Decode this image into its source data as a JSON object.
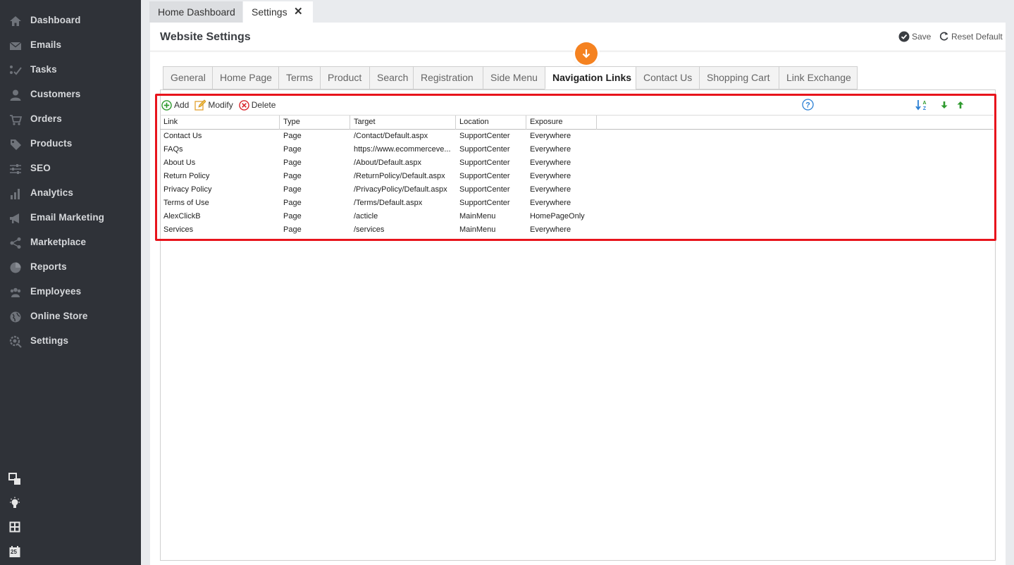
{
  "sidebar": {
    "items": [
      {
        "label": "Dashboard",
        "icon": "home-icon"
      },
      {
        "label": "Emails",
        "icon": "envelope-icon"
      },
      {
        "label": "Tasks",
        "icon": "tasks-icon"
      },
      {
        "label": "Customers",
        "icon": "user-icon"
      },
      {
        "label": "Orders",
        "icon": "cart-icon"
      },
      {
        "label": "Products",
        "icon": "tag-icon"
      },
      {
        "label": "SEO",
        "icon": "sliders-icon"
      },
      {
        "label": "Analytics",
        "icon": "bar-chart-icon"
      },
      {
        "label": "Email Marketing",
        "icon": "megaphone-icon"
      },
      {
        "label": "Marketplace",
        "icon": "share-icon"
      },
      {
        "label": "Reports",
        "icon": "pie-chart-icon"
      },
      {
        "label": "Employees",
        "icon": "users-icon"
      },
      {
        "label": "Online Store",
        "icon": "globe-icon"
      },
      {
        "label": "Settings",
        "icon": "gear-search-icon"
      }
    ],
    "bottom_icons": [
      "windows-icon",
      "lightbulb-icon",
      "calculator-icon",
      "calendar-icon"
    ],
    "calendar_day": "25"
  },
  "top_tabs": {
    "home": "Home Dashboard",
    "settings": "Settings",
    "close_glyph": "✕"
  },
  "panel": {
    "title": "Website Settings",
    "save_label": "Save",
    "reset_label": "Reset Default"
  },
  "settings_tabs": [
    {
      "label": "General",
      "active": false
    },
    {
      "label": "Home Page",
      "active": false
    },
    {
      "label": "Terms",
      "active": false
    },
    {
      "label": "Product",
      "active": false
    },
    {
      "label": "Search",
      "active": false
    },
    {
      "label": "Registration",
      "active": false
    },
    {
      "label": "Side Menu",
      "active": false
    },
    {
      "label": "Navigation Links",
      "active": true
    },
    {
      "label": "Contact Us",
      "active": false
    },
    {
      "label": "Shopping Cart",
      "active": false
    },
    {
      "label": "Link Exchange",
      "active": false
    }
  ],
  "toolbar": {
    "add": "Add",
    "modify": "Modify",
    "delete": "Delete"
  },
  "grid": {
    "columns": [
      "Link",
      "Type",
      "Target",
      "Location",
      "Exposure"
    ],
    "rows": [
      [
        "Contact Us",
        "Page",
        "/Contact/Default.aspx",
        "SupportCenter",
        "Everywhere"
      ],
      [
        "FAQs",
        "Page",
        "https://www.ecommerceve...",
        "SupportCenter",
        "Everywhere"
      ],
      [
        "About Us",
        "Page",
        "/About/Default.aspx",
        "SupportCenter",
        "Everywhere"
      ],
      [
        "Return Policy",
        "Page",
        "/ReturnPolicy/Default.aspx",
        "SupportCenter",
        "Everywhere"
      ],
      [
        "Privacy Policy",
        "Page",
        "/PrivacyPolicy/Default.aspx",
        "SupportCenter",
        "Everywhere"
      ],
      [
        "Terms of Use",
        "Page",
        "/Terms/Default.aspx",
        "SupportCenter",
        "Everywhere"
      ],
      [
        "AlexClickB",
        "Page",
        "/acticle",
        "MainMenu",
        "HomePageOnly"
      ],
      [
        "Services",
        "Page",
        "/services",
        "MainMenu",
        "Everywhere"
      ]
    ]
  },
  "colors": {
    "sidebar_bg": "#2f3238",
    "accent_orange": "#f58220",
    "highlight_red": "#e8141c",
    "green_arrow": "#2e9a2e"
  }
}
